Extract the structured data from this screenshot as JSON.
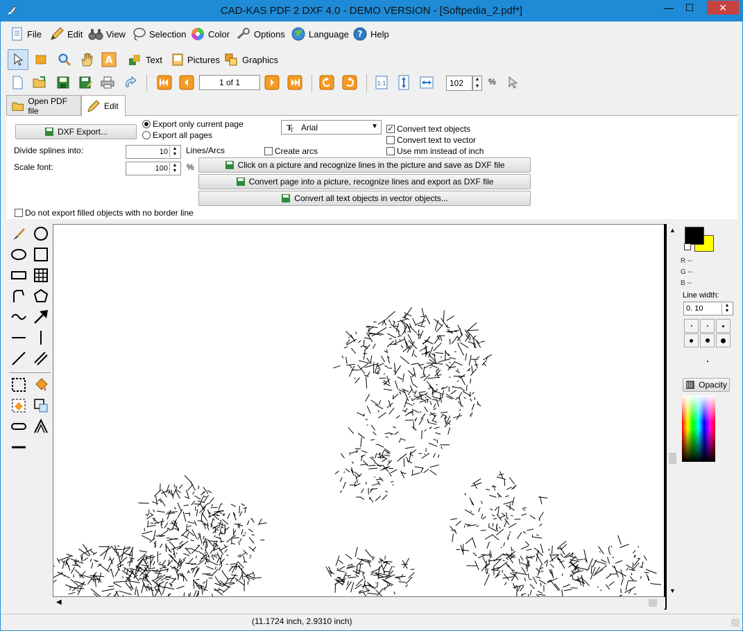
{
  "window": {
    "title": "CAD-KAS PDF 2 DXF 4.0 - DEMO VERSION - [Softpedia_2.pdf*]",
    "minimize": "—",
    "maximize": "☐",
    "close": "✕",
    "app_icon": "pen-nib-icon"
  },
  "menu": [
    {
      "label": "File",
      "icon": "document-icon"
    },
    {
      "label": "Edit",
      "icon": "pencil-icon"
    },
    {
      "label": "View",
      "icon": "binoculars-icon"
    },
    {
      "label": "Selection",
      "icon": "lasso-icon"
    },
    {
      "label": "Color",
      "icon": "color-wheel-icon"
    },
    {
      "label": "Options",
      "icon": "wrench-icon"
    },
    {
      "label": "Language",
      "icon": "globe-icon"
    },
    {
      "label": "Help",
      "icon": "help-icon"
    }
  ],
  "toolbar2": {
    "text_label": "Text",
    "pictures_label": "Pictures",
    "graphics_label": "Graphics"
  },
  "navigation": {
    "page": "1 of 1",
    "zoom": "102",
    "zoom_unit": "%"
  },
  "tabs": [
    {
      "label": "Open PDF file"
    },
    {
      "label": "Edit"
    }
  ],
  "export_panel": {
    "dxf_export": "DXF Export...",
    "export_current": "Export only current page",
    "export_all": "Export all pages",
    "font": "Arial",
    "convert_text_objects": "Convert text objects",
    "convert_text_vector": "Convert text to vector",
    "use_mm": "Use mm instead of inch",
    "divide_label": "Divide splines into:",
    "divide_value": "10",
    "divide_unit": "Lines/Arcs",
    "create_arcs": "Create arcs",
    "scale_label": "Scale font:",
    "scale_value": "100",
    "scale_unit": "%",
    "btn_picture": "Click on a picture and recognize lines in the picture and save as DXF file",
    "btn_convert_page": "Convert page into a picture, recognize lines and export as DXF file",
    "btn_convert_text": "Convert all text objects in vector objects...",
    "no_filled": "Do not export filled objects with no border line"
  },
  "right_panel": {
    "r": "R --",
    "g": "G --",
    "b": "B --",
    "line_width_label": "Line width:",
    "line_width_value": "0. 10",
    "opacity": "Opacity",
    "fg_color": "#000000",
    "bg_color": "#ffff00"
  },
  "status": {
    "coords": "(11.1724 inch, 2.9310 inch)"
  }
}
